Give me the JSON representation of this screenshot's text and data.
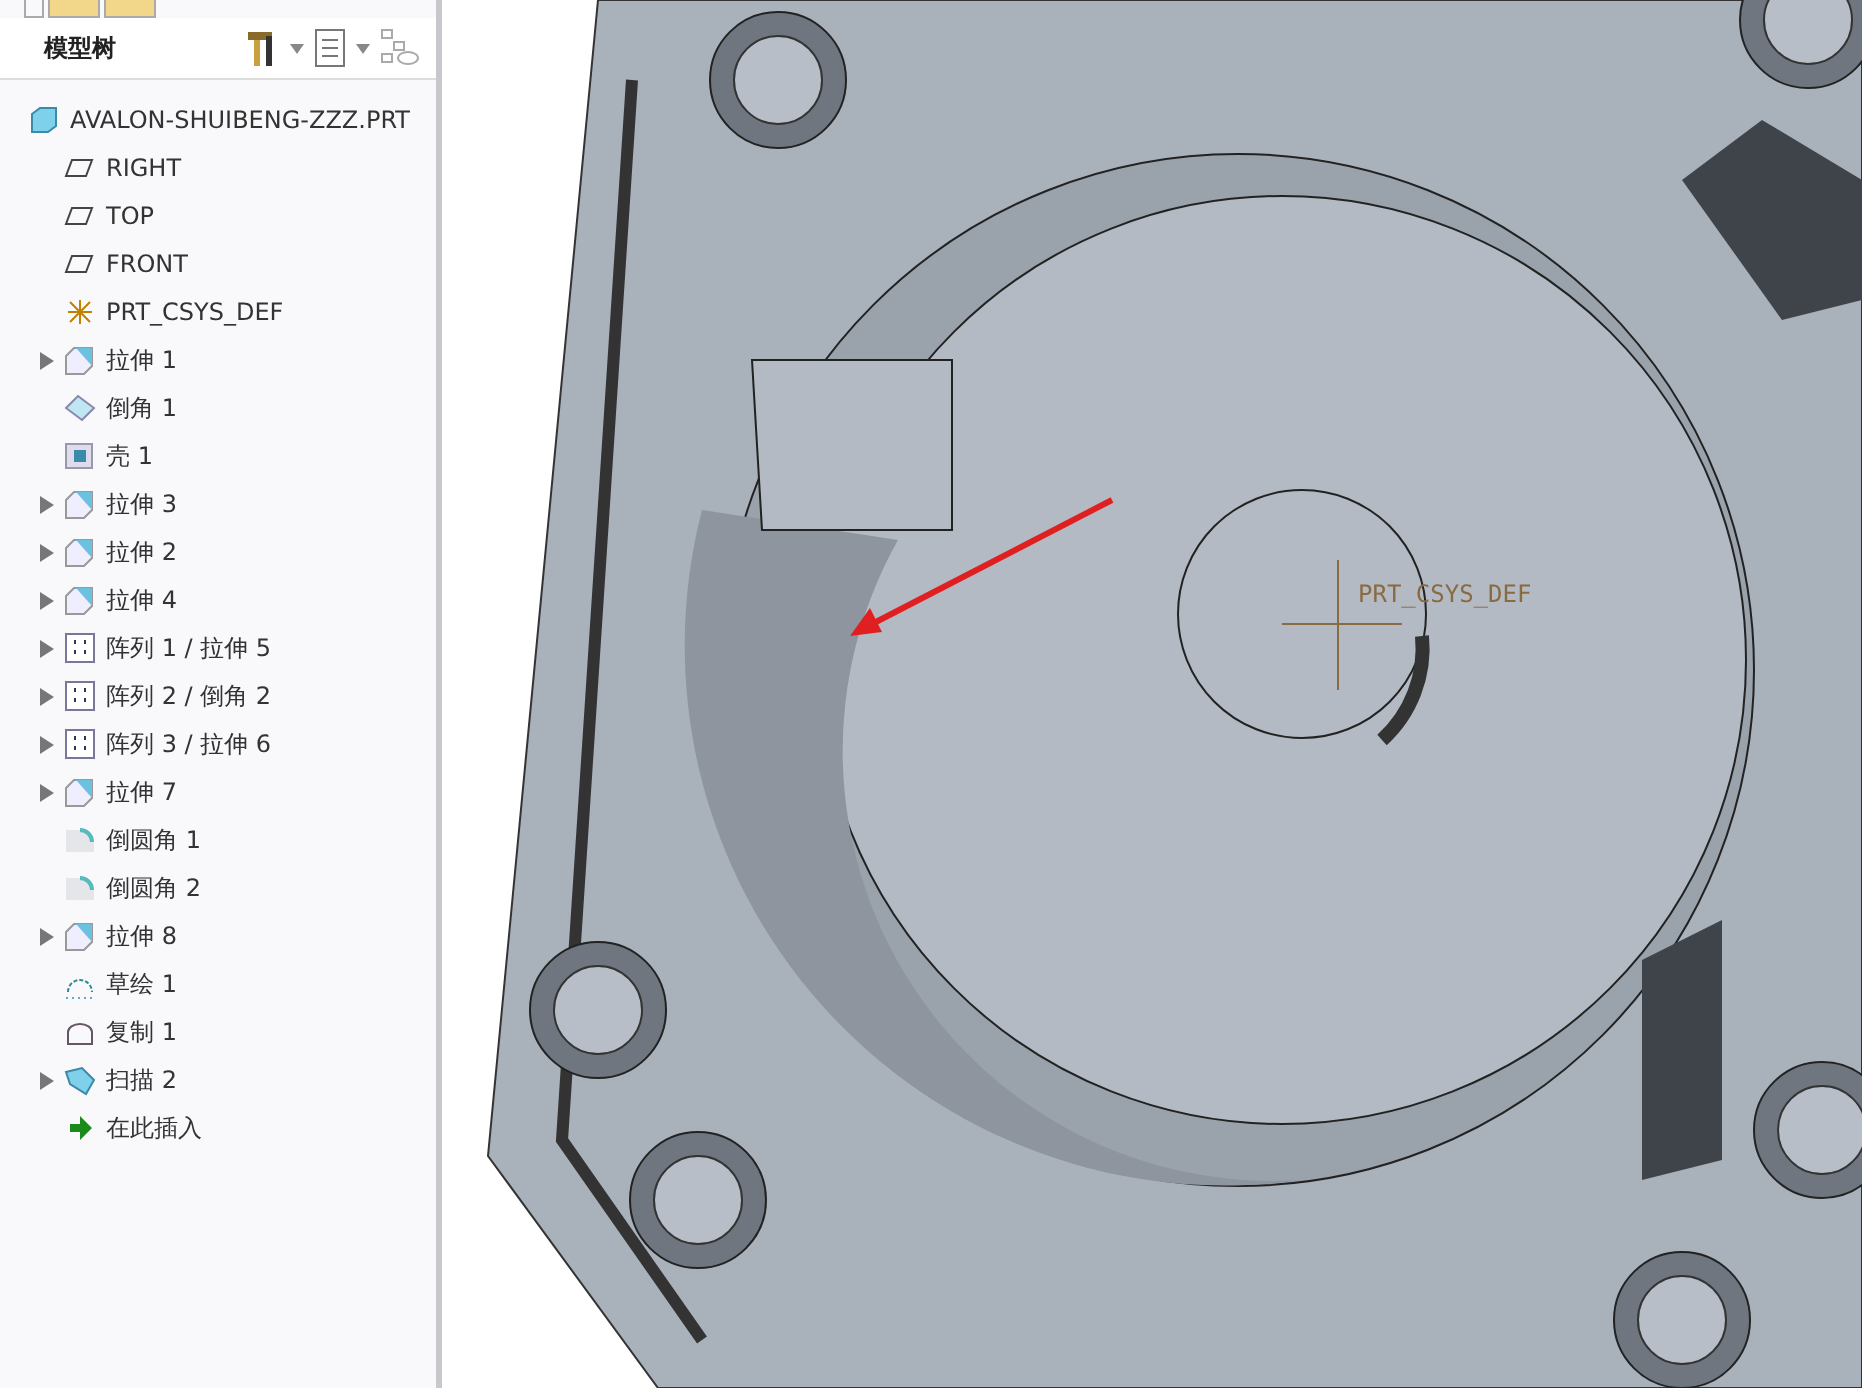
{
  "model_tree": {
    "title": "模型树",
    "items": [
      {
        "label": "AVALON-SHUIBENG-ZZZ.PRT",
        "kind": "part",
        "expandable": false
      },
      {
        "label": "RIGHT",
        "kind": "plane",
        "expandable": false
      },
      {
        "label": "TOP",
        "kind": "plane",
        "expandable": false
      },
      {
        "label": "FRONT",
        "kind": "plane",
        "expandable": false
      },
      {
        "label": "PRT_CSYS_DEF",
        "kind": "csys",
        "expandable": false
      },
      {
        "label": "拉伸 1",
        "kind": "extrude",
        "expandable": true
      },
      {
        "label": "倒角 1",
        "kind": "chamfer",
        "expandable": false
      },
      {
        "label": "壳 1",
        "kind": "shell",
        "expandable": false
      },
      {
        "label": "拉伸 3",
        "kind": "extrude",
        "expandable": true
      },
      {
        "label": "拉伸 2",
        "kind": "extrude",
        "expandable": true
      },
      {
        "label": "拉伸 4",
        "kind": "extrude",
        "expandable": true
      },
      {
        "label": "阵列 1 / 拉伸 5",
        "kind": "pattern",
        "expandable": true
      },
      {
        "label": "阵列 2 / 倒角 2",
        "kind": "pattern",
        "expandable": true
      },
      {
        "label": "阵列 3 / 拉伸 6",
        "kind": "pattern",
        "expandable": true
      },
      {
        "label": "拉伸 7",
        "kind": "extrude",
        "expandable": true
      },
      {
        "label": "倒圆角 1",
        "kind": "round",
        "expandable": false
      },
      {
        "label": "倒圆角 2",
        "kind": "round",
        "expandable": false
      },
      {
        "label": "拉伸 8",
        "kind": "extrude",
        "expandable": true
      },
      {
        "label": "草绘 1",
        "kind": "sketch",
        "expandable": false
      },
      {
        "label": "复制 1",
        "kind": "copy",
        "expandable": false
      },
      {
        "label": "扫描 2",
        "kind": "sweep",
        "expandable": true
      },
      {
        "label": "在此插入",
        "kind": "insert",
        "expandable": false
      }
    ]
  },
  "viewport": {
    "csys_label": "PRT_CSYS_DEF"
  }
}
